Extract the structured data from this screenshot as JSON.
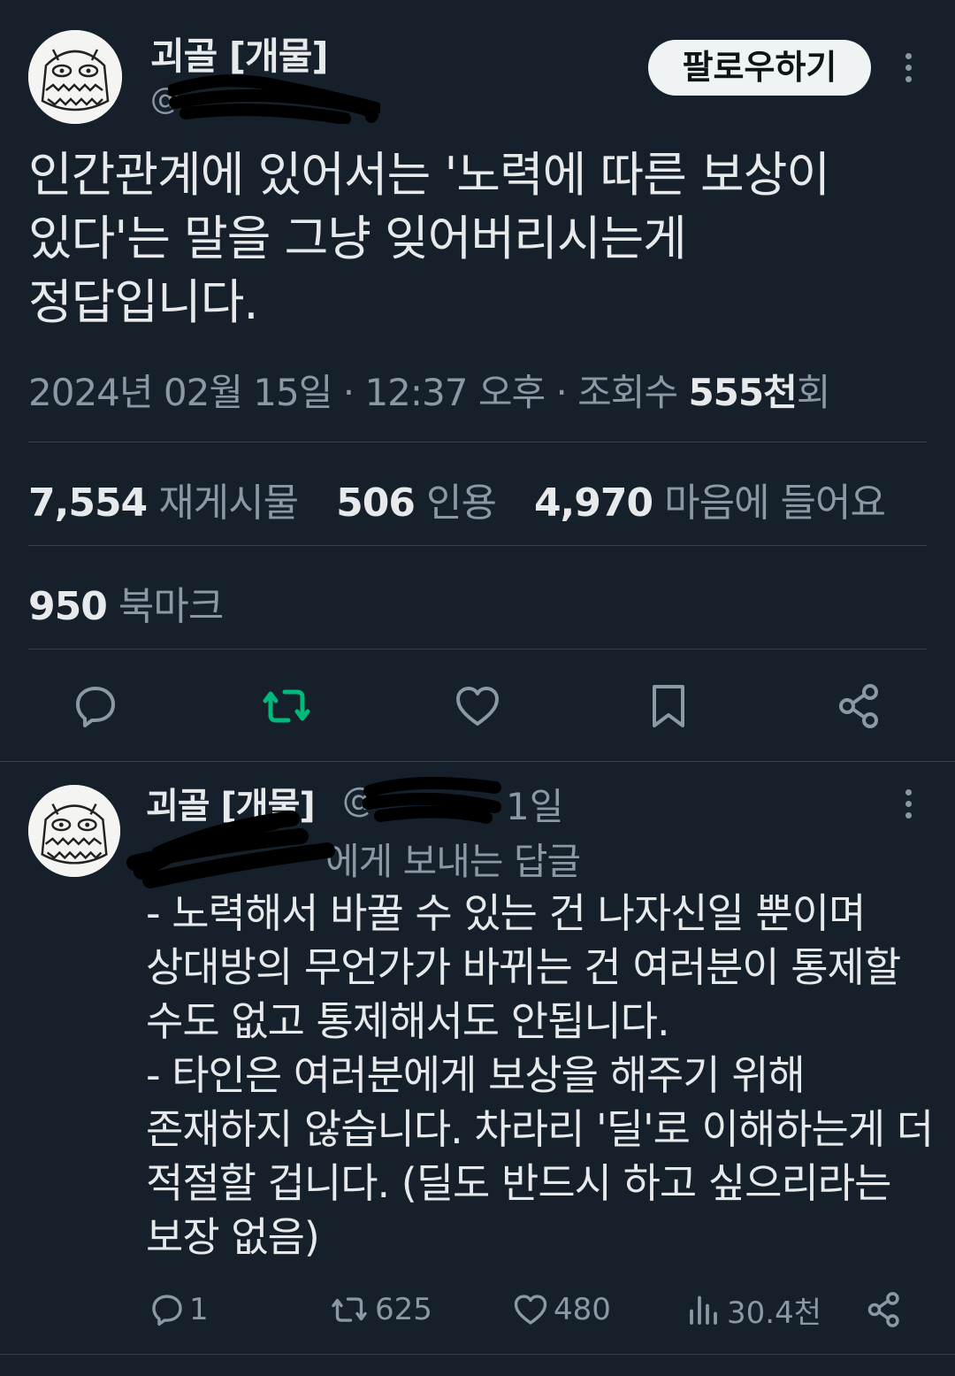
{
  "post": {
    "author_name": "괴골 [개물]",
    "handle": "@",
    "follow_label": "팔로우하기",
    "body": "인간관계에 있어서는 '노력에 따른 보상이\n있다'는 말을 그냥 잊어버리시는게\n정답입니다.",
    "date": "2024년 02월 15일 · 12:37 오후 · 조회수 ",
    "views_value": "555천",
    "views_suffix": "회",
    "stats": {
      "reposts_count": "7,554",
      "reposts_label": "재게시물",
      "quotes_count": "506",
      "quotes_label": "인용",
      "likes_count": "4,970",
      "likes_label": "마음에 들어요",
      "bookmarks_count": "950",
      "bookmarks_label": "북마크"
    },
    "colors": {
      "repost_active": "#00ba7c",
      "follow_bg": "#eff3f4"
    },
    "icons": [
      "reply-icon",
      "repost-icon",
      "like-icon",
      "bookmark-icon",
      "share-icon"
    ]
  },
  "reply": {
    "author_name": "괴골 [개물]",
    "handle": "@",
    "time": "1일",
    "reply_to": "에게 보내는 답글",
    "body": "- 노력해서 바꿀 수 있는 건 나자신일 뿐이며\n상대방의 무언가가 바뀌는 건 여러분이 통제할\n수도 없고 통제해서도 안됩니다.\n- 타인은 여러분에게 보상을 해주기 위해\n존재하지 않습니다. 차라리 '딜'로 이해하는게 더\n적절할 겁니다. (딜도 반드시 하고 싶으리라는\n보장 없음)",
    "reply_count": "1",
    "repost_count": "625",
    "like_count": "480",
    "view_count": "30.4천"
  }
}
